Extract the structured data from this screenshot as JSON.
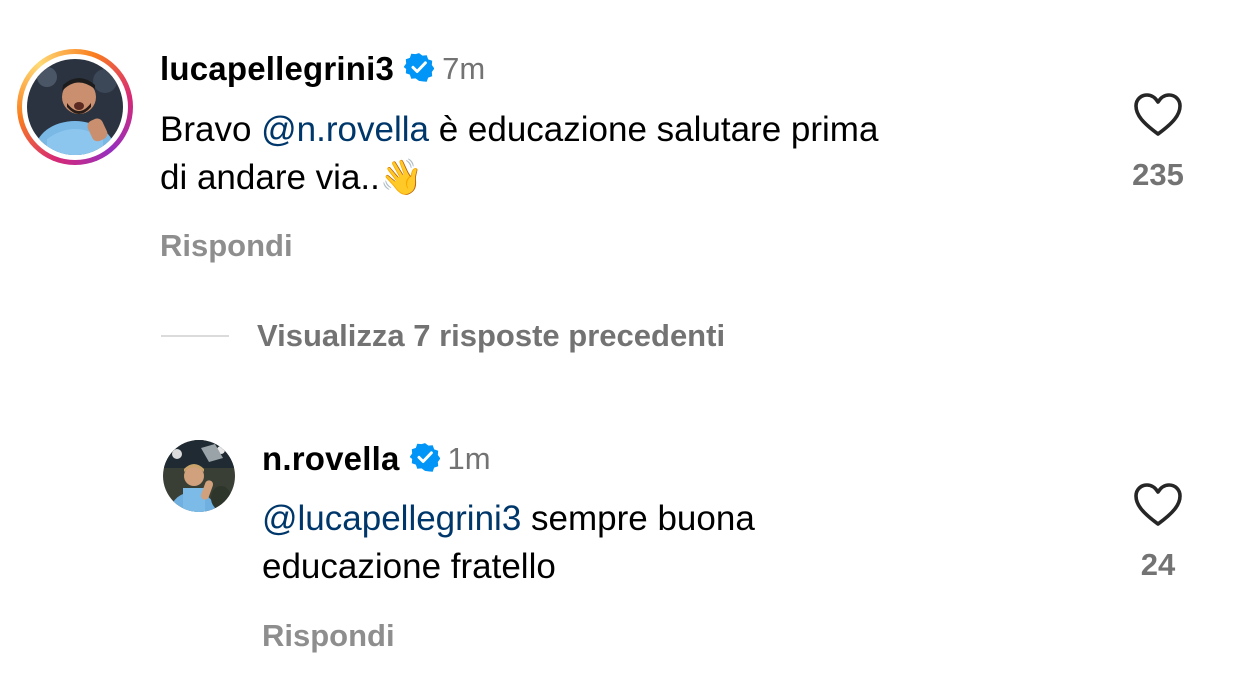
{
  "comments": [
    {
      "username": "lucapellegrini3",
      "time": "7m",
      "mention": "@n.rovella",
      "text_before": "Bravo ",
      "text_after": " è educazione salutare prima",
      "text_line2": "di andare via..",
      "emoji": "👋",
      "likes": "235",
      "reply_label": "Rispondi",
      "verified_icon": "verified-badge-icon",
      "like_icon": "heart-icon"
    },
    {
      "username": "n.rovella",
      "time": "1m",
      "mention": "@lucapellegrini3",
      "text_after": " sempre buona",
      "text_line2": "educazione fratello",
      "likes": "24",
      "reply_label": "Rispondi",
      "verified_icon": "verified-badge-icon",
      "like_icon": "heart-icon"
    }
  ],
  "thread": {
    "view_previous_label": "Visualizza 7 risposte precedenti"
  },
  "colors": {
    "mention": "#00376b",
    "verified": "#0095f6",
    "muted": "#737373",
    "reply": "#8e8e8e"
  }
}
